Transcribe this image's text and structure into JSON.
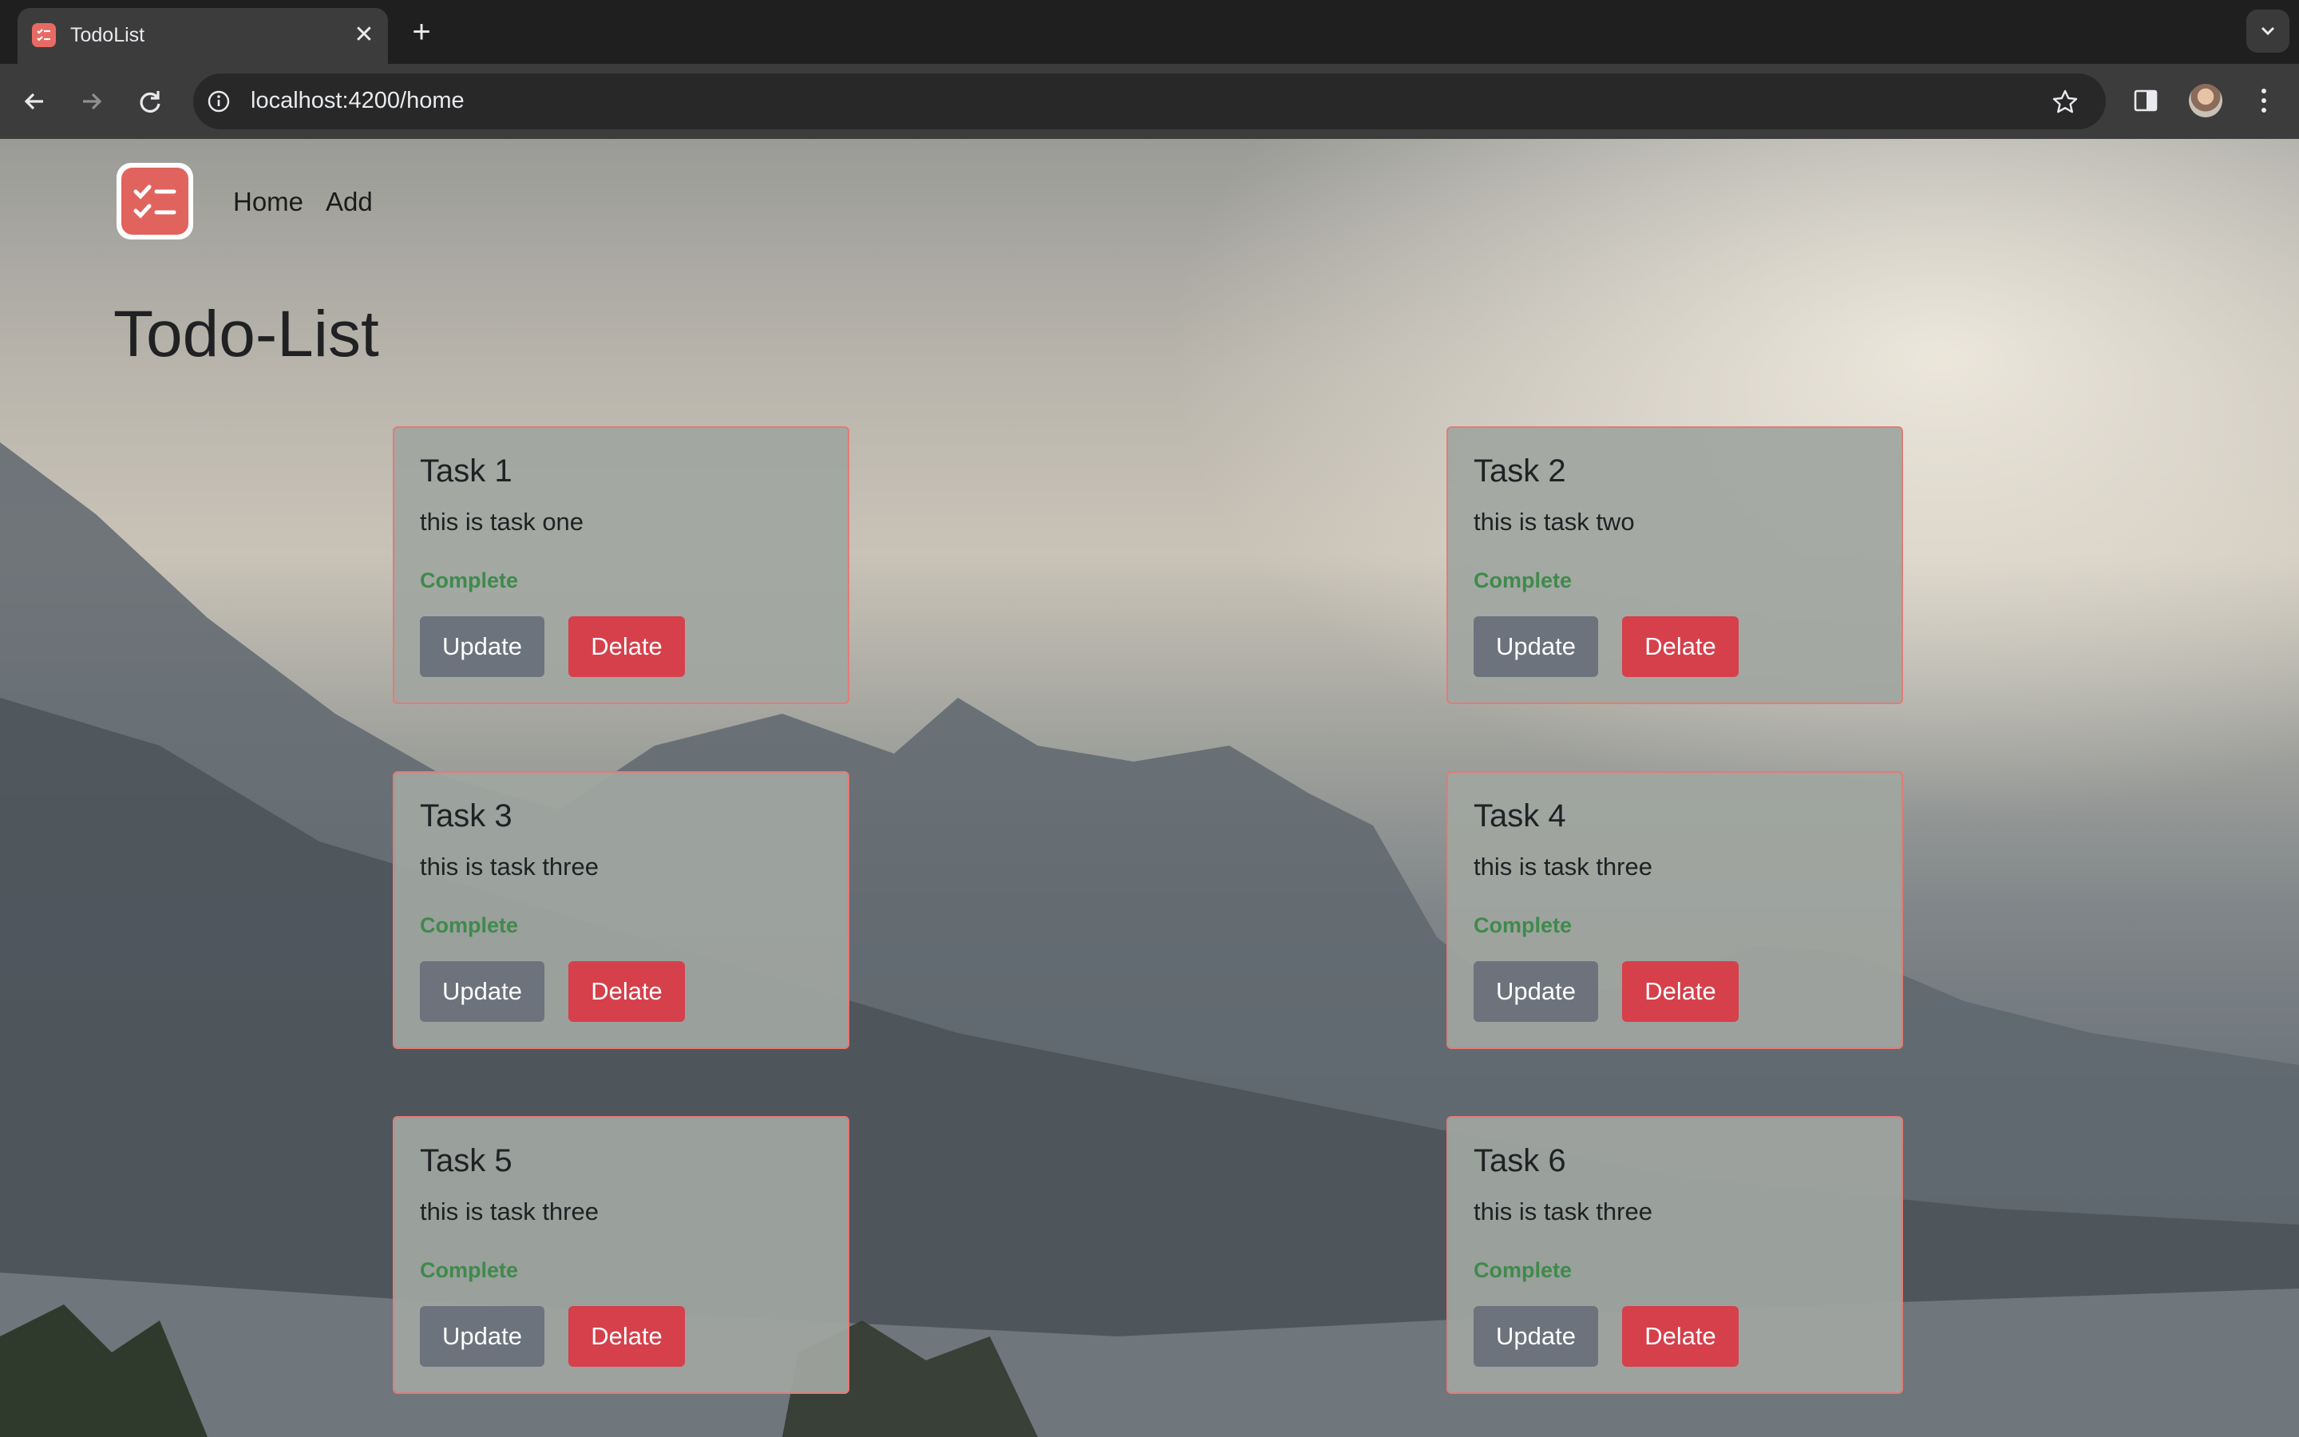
{
  "browser": {
    "tab_title": "TodoList",
    "tab_close": "✕",
    "new_tab": "+",
    "url": "localhost:4200/home",
    "icons": [
      "back-arrow-icon",
      "forward-arrow-icon",
      "reload-icon",
      "site-info-icon",
      "bookmark-star-icon",
      "side-panel-icon",
      "profile-avatar",
      "kebab-menu-icon",
      "tab-search-chevron-icon"
    ]
  },
  "app": {
    "nav": {
      "home_label": "Home",
      "add_label": "Add"
    },
    "page_title": "Todo-List",
    "tasks": [
      {
        "title": "Task 1",
        "description": "this is task one",
        "status": "Complete",
        "update_label": "Update",
        "delete_label": "Delate"
      },
      {
        "title": "Task 2",
        "description": "this is task two",
        "status": "Complete",
        "update_label": "Update",
        "delete_label": "Delate"
      },
      {
        "title": "Task 3",
        "description": "this is task three",
        "status": "Complete",
        "update_label": "Update",
        "delete_label": "Delate"
      },
      {
        "title": "Task 4",
        "description": "this is task three",
        "status": "Complete",
        "update_label": "Update",
        "delete_label": "Delate"
      },
      {
        "title": "Task 5",
        "description": "this is task three",
        "status": "Complete",
        "update_label": "Update",
        "delete_label": "Delate"
      },
      {
        "title": "Task 6",
        "description": "this is task three",
        "status": "Complete",
        "update_label": "Update",
        "delete_label": "Delate"
      }
    ]
  },
  "colors": {
    "accent": "#e0635d",
    "update_button": "#6c737d",
    "delete_button": "#d5404b",
    "status_complete": "#3f8a4c",
    "card_border": "#e37b76"
  }
}
